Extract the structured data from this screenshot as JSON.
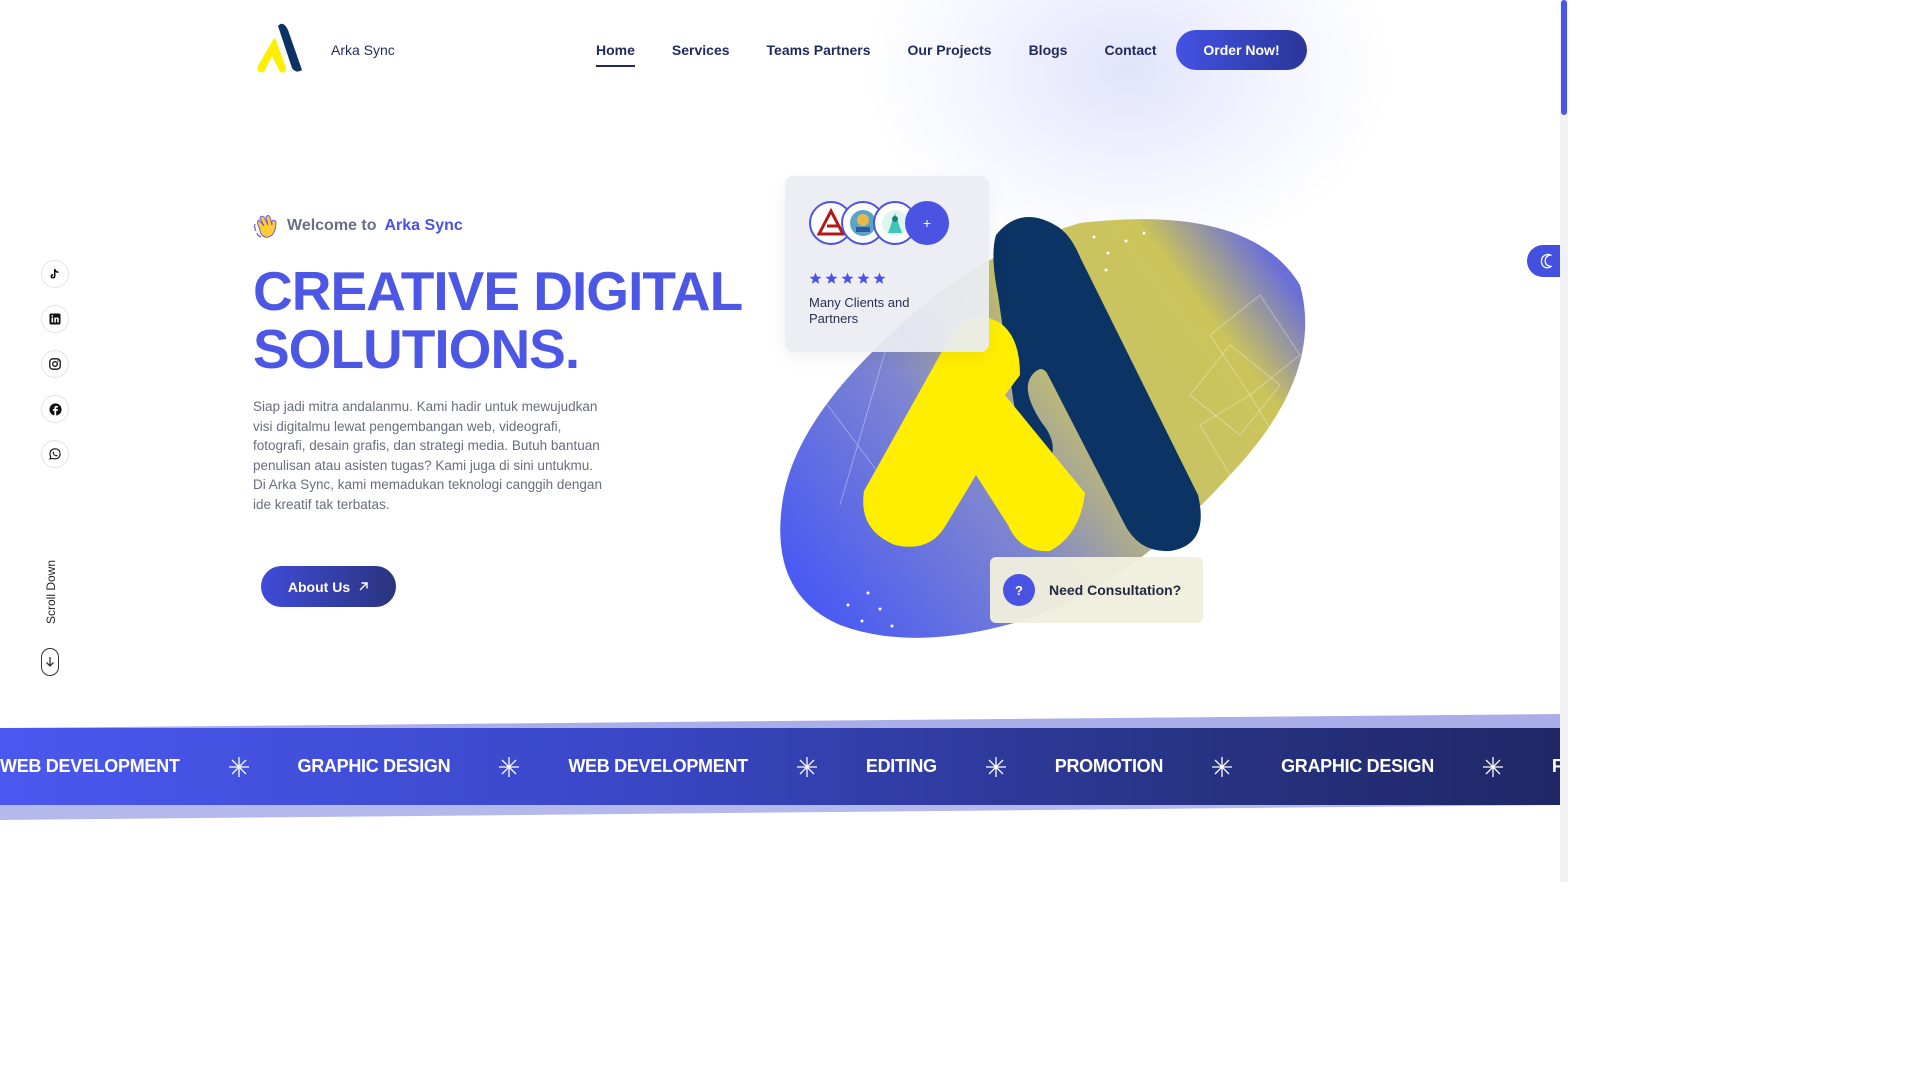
{
  "header": {
    "brand": "Arka Sync",
    "nav": [
      "Home",
      "Services",
      "Teams Partners",
      "Our Projects",
      "Blogs",
      "Contact"
    ],
    "active_nav": "Home",
    "order_label": "Order Now!"
  },
  "social": [
    "tiktok-icon",
    "linkedin-icon",
    "instagram-icon",
    "facebook-icon",
    "whatsapp-icon"
  ],
  "scroll_label": "Scroll Down",
  "hero": {
    "welcome_prefix": "Welcome to",
    "welcome_brand": "Arka Sync",
    "headline_line1": "CREATIVE DIGITAL",
    "headline_line2": "SOLUTIONS.",
    "description": "Siap jadi mitra andalanmu. Kami hadir untuk mewujudkan visi digitalmu lewat pengembangan web, videografi, fotografi, desain grafis, dan strategi media. Butuh bantuan penulisan atau asisten tugas? Kami juga di sini untukmu. Di Arka Sync, kami memadukan teknologi canggih dengan ide kreatif tak terbatas.",
    "about_label": "About Us"
  },
  "clients_card": {
    "plus": "+",
    "rating": 5,
    "label": "Many Clients and Partners"
  },
  "consult": {
    "icon": "?",
    "label": "Need Consultation?"
  },
  "marquee": [
    "WEB DEVELOPMENT",
    "GRAPHIC DESIGN",
    "WEB DEVELOPMENT",
    "EDITING",
    "PROMOTION",
    "GRAPHIC DESIGN",
    "FOH C"
  ],
  "colors": {
    "accent": "#4a53e2",
    "navy": "#1f2a5a",
    "logo_navy": "#0b3363",
    "logo_yellow": "#ffee00"
  }
}
